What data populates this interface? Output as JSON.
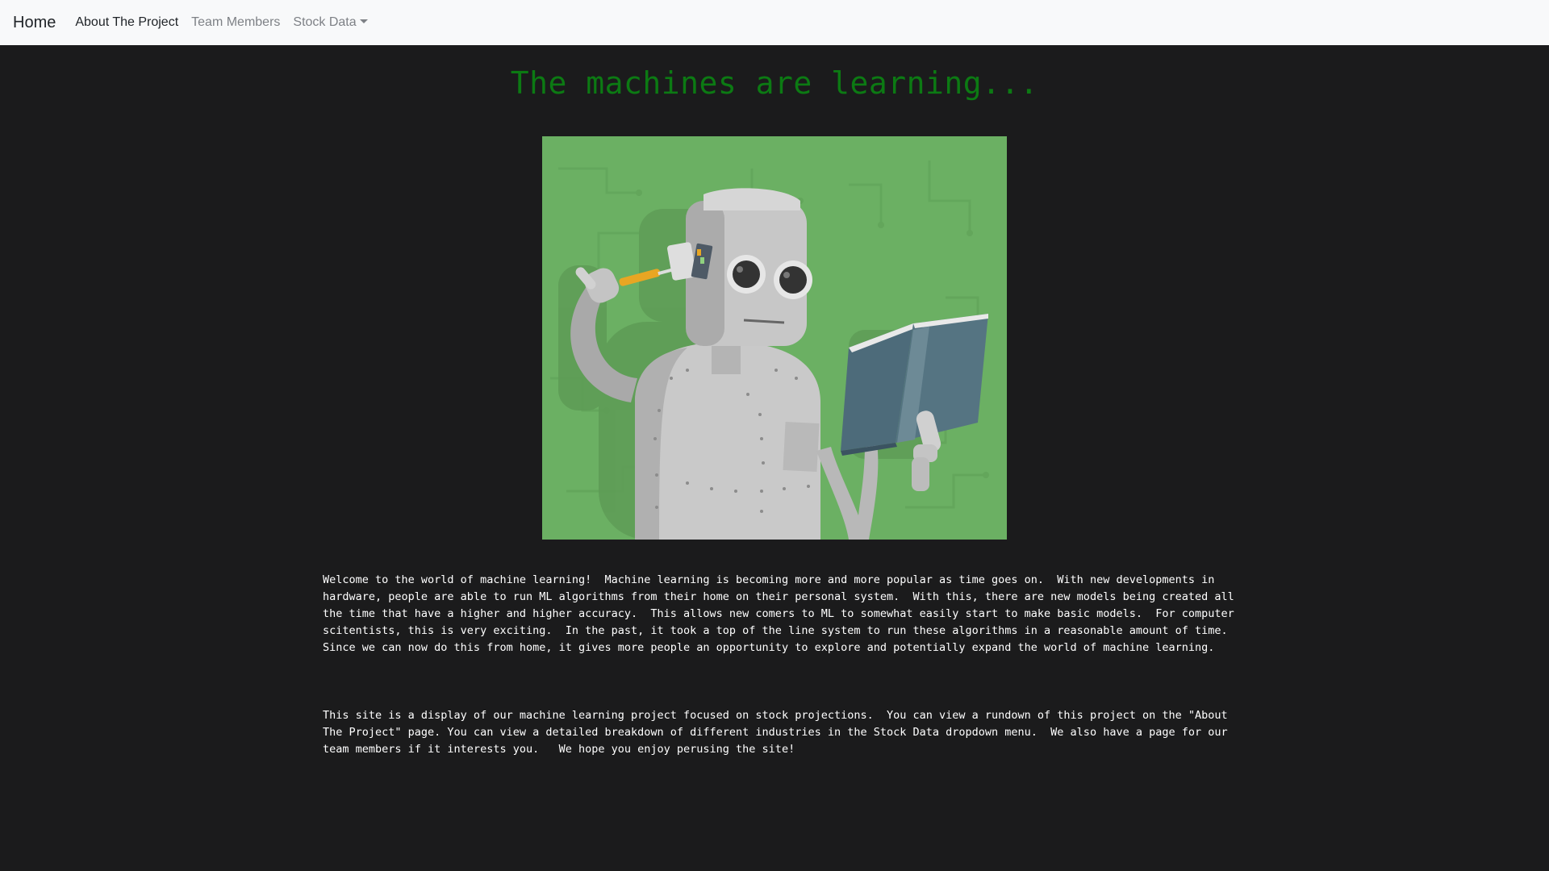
{
  "nav": {
    "brand": "Home",
    "links": [
      "About The Project",
      "Team Members",
      "Stock Data"
    ]
  },
  "hero": {
    "title": "The machines are learning..."
  },
  "content": {
    "paragraphs": [
      "Welcome to the world of machine learning!  Machine learning is becoming more and more popular as time goes on.  With new developments in hardware, people are able to run ML algorithms from their home on their personal system.  With this, there are new models being created all the time that have a higher and higher accuracy.  This allows new comers to ML to somewhat easily start to make basic models.  For computer scitentists, this is very exciting.  In the past, it took a top of the line system to run these algorithms in a reasonable amount of time.  Since we can now do this from home, it gives more people an opportunity to explore and potentially expand the world of machine learning.",
      "This site is a display of our machine learning project focused on stock projections.  You can view a rundown of this project on the \"About The Project\" page. You can view a detailed breakdown of different industries in the Stock Data dropdown menu.  We also have a page for our team members if it interests you.   We hope you enjoy perusing the site!"
    ]
  },
  "colors": {
    "navbar_bg": "#f8f9fa",
    "page_bg": "#1b1b1c",
    "title_green": "#0c7a13",
    "image_bg_green": "#6bb063"
  }
}
